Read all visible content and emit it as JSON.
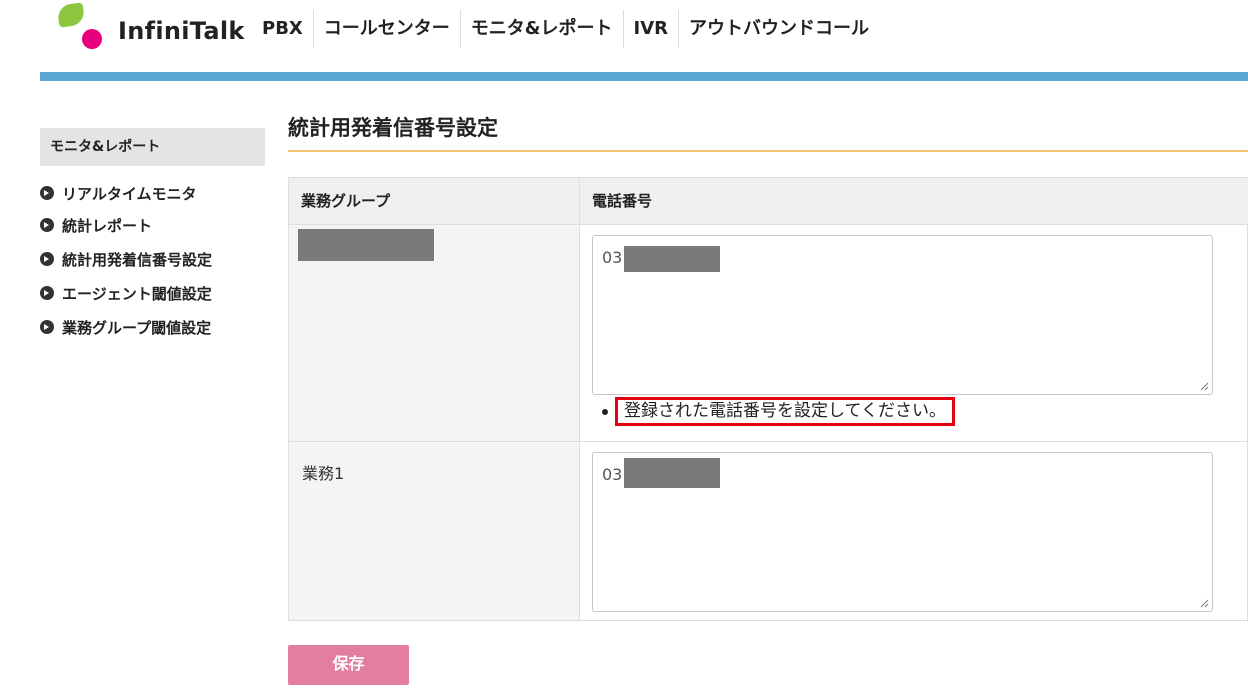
{
  "brand": {
    "name": "InfiniTalk",
    "logo_colors": [
      "#8cc63f",
      "#e6007e"
    ]
  },
  "nav": {
    "items": [
      {
        "label": "PBX"
      },
      {
        "label": "コールセンター"
      },
      {
        "label": "モニタ&レポート"
      },
      {
        "label": "IVR"
      },
      {
        "label": "アウトバウンドコール"
      }
    ]
  },
  "sidebar": {
    "heading": "モニタ&レポート",
    "items": [
      {
        "label": "リアルタイムモニタ"
      },
      {
        "label": "統計レポート"
      },
      {
        "label": "統計用発着信番号設定"
      },
      {
        "label": "エージェント閾値設定"
      },
      {
        "label": "業務グループ閾値設定"
      }
    ]
  },
  "page": {
    "title": "統計用発着信番号設定"
  },
  "table": {
    "headers": {
      "group": "業務グループ",
      "phone": "電話番号"
    },
    "rows": [
      {
        "group": "",
        "phone_prefix": "03",
        "error": "登録された電話番号を設定してください。"
      },
      {
        "group": "業務1",
        "phone_prefix": "03"
      }
    ]
  },
  "actions": {
    "save_label": "保存"
  },
  "colors": {
    "accent_bar": "#5ba7d6",
    "title_rule": "#f1c56b",
    "save_button": "#e27fa0",
    "error_border": "#e60012"
  }
}
